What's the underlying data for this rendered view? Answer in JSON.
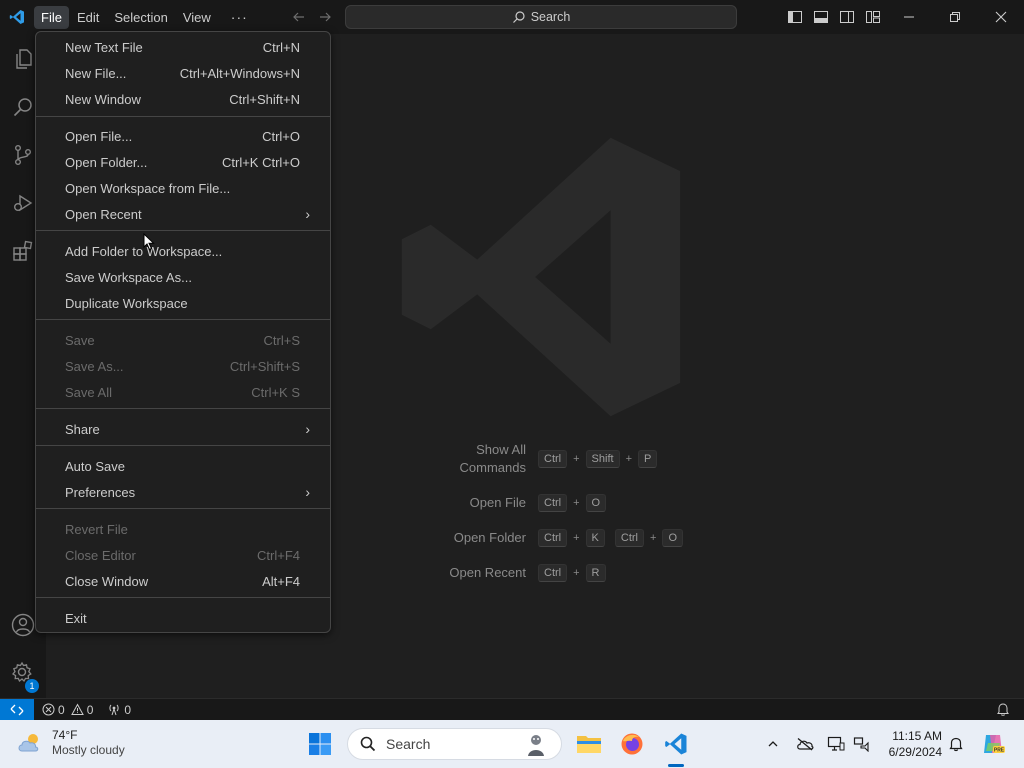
{
  "titlebar": {
    "menus": [
      "File",
      "Edit",
      "Selection",
      "View"
    ],
    "more": "···",
    "search_label": "Search"
  },
  "file_menu": {
    "items": [
      {
        "label": "New Text File",
        "shortcut": "Ctrl+N"
      },
      {
        "label": "New File...",
        "shortcut": "Ctrl+Alt+Windows+N"
      },
      {
        "label": "New Window",
        "shortcut": "Ctrl+Shift+N"
      },
      {
        "label": "Open File...",
        "shortcut": "Ctrl+O"
      },
      {
        "label": "Open Folder...",
        "shortcut": "Ctrl+K Ctrl+O"
      },
      {
        "label": "Open Workspace from File...",
        "shortcut": ""
      },
      {
        "label": "Open Recent",
        "shortcut": ""
      },
      {
        "label": "Add Folder to Workspace...",
        "shortcut": ""
      },
      {
        "label": "Save Workspace As...",
        "shortcut": ""
      },
      {
        "label": "Duplicate Workspace",
        "shortcut": ""
      },
      {
        "label": "Save",
        "shortcut": "Ctrl+S"
      },
      {
        "label": "Save As...",
        "shortcut": "Ctrl+Shift+S"
      },
      {
        "label": "Save All",
        "shortcut": "Ctrl+K S"
      },
      {
        "label": "Share",
        "shortcut": ""
      },
      {
        "label": "Auto Save",
        "shortcut": ""
      },
      {
        "label": "Preferences",
        "shortcut": ""
      },
      {
        "label": "Revert File",
        "shortcut": ""
      },
      {
        "label": "Close Editor",
        "shortcut": "Ctrl+F4"
      },
      {
        "label": "Close Window",
        "shortcut": "Alt+F4"
      },
      {
        "label": "Exit",
        "shortcut": ""
      }
    ]
  },
  "welcome": {
    "show_all_commands_1": "Show All",
    "show_all_commands_2": "Commands",
    "open_file": "Open File",
    "open_folder": "Open Folder",
    "open_recent": "Open Recent",
    "keys": {
      "ctrl": "Ctrl",
      "shift": "Shift",
      "p": "P",
      "o": "O",
      "k": "K",
      "r": "R",
      "plus": "+"
    }
  },
  "activitybar": {
    "accounts_badge": "1"
  },
  "statusbar": {
    "errors": "0",
    "warnings": "0",
    "ports": "0"
  },
  "taskbar": {
    "weather_temp": "74°F",
    "weather_desc": "Mostly cloudy",
    "search_label": "Search",
    "time": "11:15 AM",
    "date": "6/29/2024"
  },
  "colors": {
    "accent": "#0078d4",
    "menu_bg": "#1f1f1f",
    "titlebar_bg": "#181818"
  }
}
